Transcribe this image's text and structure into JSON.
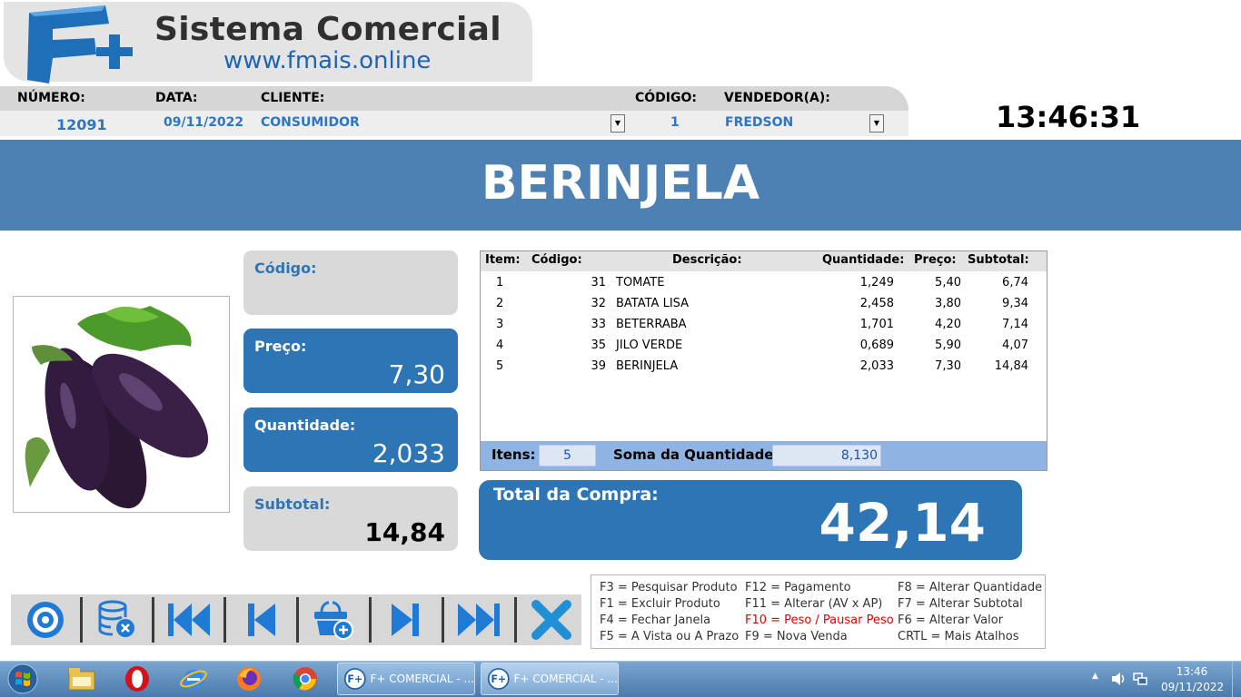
{
  "brand": {
    "title": "Sistema Comercial",
    "url": "www.fmais.online",
    "logo_text": "F+"
  },
  "header": {
    "numero_label": "NÚMERO:",
    "numero_value": "12091",
    "data_label": "DATA:",
    "data_value": "09/11/2022",
    "cliente_label": "CLIENTE:",
    "cliente_value": "CONSUMIDOR",
    "codigo_label": "CÓDIGO:",
    "codigo_value": "1",
    "vendedor_label": "VENDEDOR(A):",
    "vendedor_value": "FREDSON"
  },
  "clock": "13:46:31",
  "product": {
    "name": "BERINJELA",
    "image": "eggplant-photo"
  },
  "fields": {
    "codigo_label": "Código:",
    "codigo_value": "",
    "preco_label": "Preço:",
    "preco_value": "7,30",
    "quantidade_label": "Quantidade:",
    "quantidade_value": "2,033",
    "subtotal_label": "Subtotal:",
    "subtotal_value": "14,84"
  },
  "table": {
    "headers": {
      "item": "Item:",
      "codigo": "Código:",
      "descricao": "Descrição:",
      "quantidade": "Quantidade:",
      "preco": "Preço:",
      "subtotal": "Subtotal:"
    },
    "rows": [
      {
        "item": "1",
        "codigo": "31",
        "descricao": "TOMATE",
        "quantidade": "1,249",
        "preco": "5,40",
        "subtotal": "6,74"
      },
      {
        "item": "2",
        "codigo": "32",
        "descricao": "BATATA LISA",
        "quantidade": "2,458",
        "preco": "3,80",
        "subtotal": "9,34"
      },
      {
        "item": "3",
        "codigo": "33",
        "descricao": "BETERRABA",
        "quantidade": "1,701",
        "preco": "4,20",
        "subtotal": "7,14"
      },
      {
        "item": "4",
        "codigo": "35",
        "descricao": "JILO VERDE",
        "quantidade": "0,689",
        "preco": "5,90",
        "subtotal": "4,07"
      },
      {
        "item": "5",
        "codigo": "39",
        "descricao": "BERINJELA",
        "quantidade": "2,033",
        "preco": "7,30",
        "subtotal": "14,84"
      }
    ],
    "itens_label": "Itens:",
    "itens_value": "5",
    "soma_label": "Soma da Quantidade:",
    "soma_value": "8,130"
  },
  "total": {
    "label": "Total da Compra:",
    "value": "42,14"
  },
  "toolbar": {
    "buttons": [
      "record-icon",
      "database-delete-icon",
      "first-record-icon",
      "previous-record-icon",
      "cart-add-icon",
      "next-record-icon",
      "last-record-icon",
      "close-icon"
    ]
  },
  "shortcuts": {
    "col1": [
      "F3 = Pesquisar Produto",
      "F1 = Excluir Produto",
      "F4 = Fechar Janela",
      "F5 = A Vista ou A Prazo"
    ],
    "col2": [
      "F12 = Pagamento",
      "F11 = Alterar (AV x AP)",
      "F10 = Peso / Pausar Peso",
      "F9 = Nova Venda"
    ],
    "col3": [
      "F8 = Alterar Quantidade",
      "F7 = Alterar Subtotal",
      "F6 = Alterar Valor",
      "CRTL = Mais Atalhos"
    ]
  },
  "taskbar": {
    "pinned": [
      "start-icon",
      "explorer-icon",
      "opera-icon",
      "internet-explorer-icon",
      "firefox-icon",
      "chrome-icon"
    ],
    "windows": [
      {
        "title": "F+ COMERCIAL - ..."
      },
      {
        "title": "F+ COMERCIAL - ..."
      }
    ],
    "time": "13:46",
    "date": "09/11/2022"
  },
  "colors": {
    "primary": "#2e75b6",
    "banner": "#4d80b3",
    "panel": "#d9d9d9",
    "foot": "#8fb4e3",
    "red": "#e00000"
  }
}
